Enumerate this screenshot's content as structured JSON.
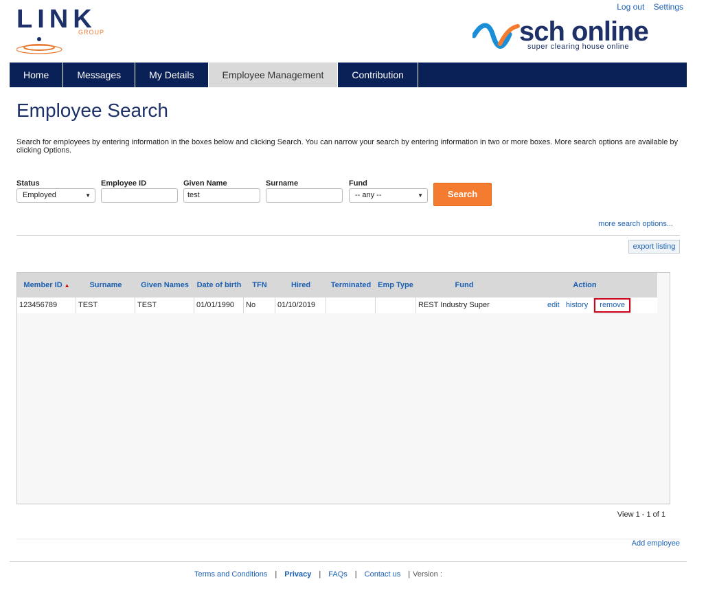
{
  "header": {
    "brand_word": "LINK",
    "brand_group": "GROUP",
    "sch_word": "sch online",
    "sch_tagline": "super clearing house online",
    "logout": "Log out",
    "settings": "Settings"
  },
  "nav": [
    {
      "label": "Home"
    },
    {
      "label": "Messages"
    },
    {
      "label": "My Details"
    },
    {
      "label": "Employee Management"
    },
    {
      "label": "Contribution"
    }
  ],
  "page": {
    "title": "Employee Search",
    "intro": "Search for employees by entering information in the boxes below and clicking Search. You can narrow your search by entering information in two or more boxes. More search options are available by clicking Options."
  },
  "search": {
    "status_label": "Status",
    "status_value": "Employed",
    "employee_id_label": "Employee ID",
    "employee_id_value": "",
    "given_name_label": "Given Name",
    "given_name_value": "test",
    "surname_label": "Surname",
    "surname_value": "",
    "fund_label": "Fund",
    "fund_value": "-- any --",
    "search_button": "Search",
    "more_options": "more search options...",
    "export": "export listing"
  },
  "grid": {
    "columns": [
      "Member ID",
      "Surname",
      "Given Names",
      "Date of birth",
      "TFN",
      "Hired",
      "Terminated",
      "Emp Type",
      "Fund",
      "Action"
    ],
    "rows": [
      {
        "member_id": "123456789",
        "surname": "TEST",
        "given_names": "TEST",
        "dob": "01/01/1990",
        "tfn": "No",
        "hired": "01/10/2019",
        "terminated": "",
        "emp_type": "",
        "fund": "REST Industry Super",
        "actions": {
          "edit": "edit",
          "history": "history",
          "remove": "remove"
        }
      }
    ],
    "pager": "View 1 - 1 of 1"
  },
  "add_employee": "Add employee",
  "footer": {
    "terms": "Terms and Conditions",
    "privacy": "Privacy",
    "faqs": "FAQs",
    "contact": "Contact us",
    "version": "Version :"
  },
  "colors": {
    "navy": "#0a2158",
    "orange": "#f47c30",
    "link": "#1a5fb4",
    "highlight": "#d0021b"
  }
}
